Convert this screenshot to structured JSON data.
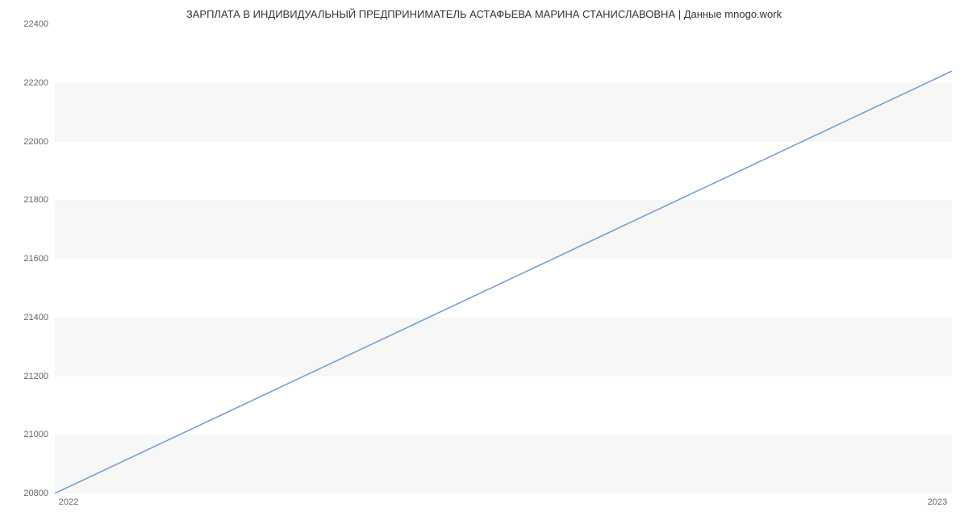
{
  "chart_data": {
    "type": "line",
    "title": "ЗАРПЛАТА В ИНДИВИДУАЛЬНЫЙ ПРЕДПРИНИМАТЕЛЬ АСТАФЬЕВА МАРИНА СТАНИСЛАВОВНА | Данные mnogo.work",
    "xlabel": "",
    "ylabel": "",
    "x_categories": [
      "2022",
      "2023"
    ],
    "y_ticks": [
      20800,
      21000,
      21200,
      21400,
      21600,
      21800,
      22000,
      22200,
      22400
    ],
    "ylim": [
      20800,
      22400
    ],
    "series": [
      {
        "name": "Зарплата",
        "x": [
          "2022",
          "2023"
        ],
        "values": [
          20800,
          22240
        ]
      }
    ],
    "line_color": "#6c9bd1",
    "background_color": "#f7f7f7",
    "band_color": "#ffffff"
  }
}
